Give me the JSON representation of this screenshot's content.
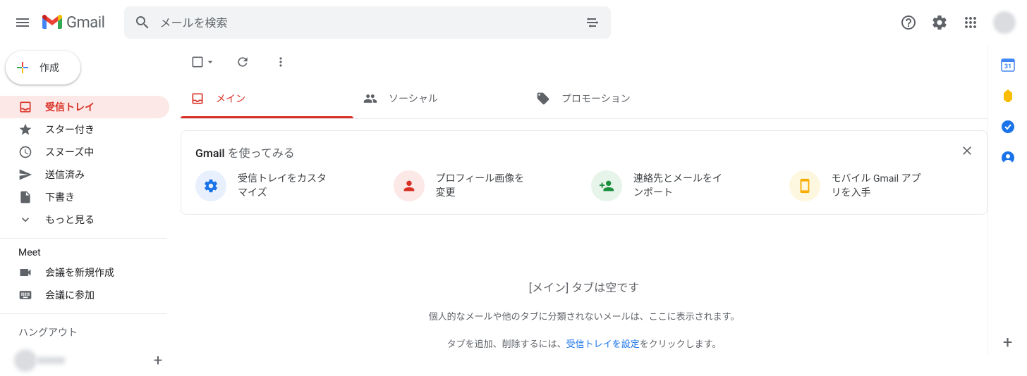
{
  "header": {
    "app_name": "Gmail",
    "search_placeholder": "メールを検索"
  },
  "compose_label": "作成",
  "sidebar": {
    "items": [
      {
        "label": "受信トレイ"
      },
      {
        "label": "スター付き"
      },
      {
        "label": "スヌーズ中"
      },
      {
        "label": "送信済み"
      },
      {
        "label": "下書き"
      },
      {
        "label": "もっと見る"
      }
    ],
    "meet_label": "Meet",
    "meet_items": [
      {
        "label": "会議を新規作成"
      },
      {
        "label": "会議に参加"
      }
    ],
    "hangout_label": "ハングアウト"
  },
  "tabs": [
    {
      "label": "メイン"
    },
    {
      "label": "ソーシャル"
    },
    {
      "label": "プロモーション"
    }
  ],
  "setup": {
    "title_bold": "Gmail",
    "title_rest": " を使ってみる",
    "items": [
      {
        "text": "受信トレイをカスタマイズ"
      },
      {
        "text": "プロフィール画像を変更"
      },
      {
        "text": "連絡先とメールをインポート"
      },
      {
        "text": "モバイル Gmail アプリを入手"
      }
    ]
  },
  "empty": {
    "title": "[メイン] タブは空です",
    "line1": "個人的なメールや他のタブに分類されないメールは、ここに表示されます。",
    "line2_before": "タブを追加、削除するには、",
    "line2_link": "受信トレイを設定",
    "line2_after": "をクリックします。"
  }
}
